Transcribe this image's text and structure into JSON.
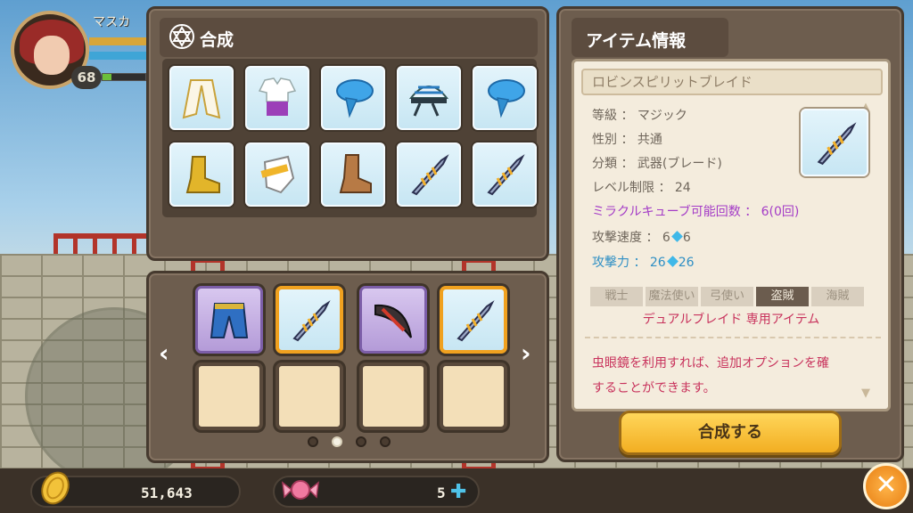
{
  "hud": {
    "player_name": "マスカ",
    "level": "68",
    "exp_fraction": 0.2
  },
  "synthesis": {
    "title": "合成",
    "items": [
      {
        "name": "white-cape"
      },
      {
        "name": "white-shirt-purple-pants"
      },
      {
        "name": "blue-bandana"
      },
      {
        "name": "blue-striped-bandana"
      },
      {
        "name": "blue-bandana"
      },
      {
        "name": "yellow-boots"
      },
      {
        "name": "white-gloves"
      },
      {
        "name": "brown-boots"
      },
      {
        "name": "blade"
      },
      {
        "name": "blade"
      }
    ],
    "materials": [
      {
        "name": "blue-pants",
        "frame": "purple"
      },
      {
        "name": "blade",
        "frame": "orange"
      },
      {
        "name": "katara",
        "frame": "purple"
      },
      {
        "name": "blade",
        "frame": "orange"
      }
    ],
    "pages": 4,
    "current_page": 2
  },
  "item_info": {
    "title": "アイテム情報",
    "item_name": "ロビンスピリットブレイド",
    "grade": "等級 ： マジック",
    "gender": "性別 ： 共通",
    "category": "分類 ： 武器(ブレード)",
    "level_req": "レベル制限 ： 24",
    "miracle_cube": "ミラクルキューブ可能回数 ： 6(0回)",
    "atk_speed_label": "攻撃速度 ： 6",
    "atk_speed_gem": "6",
    "atk_label": "攻撃力 ： 26",
    "atk_gem": "26",
    "jobs": [
      "戦士",
      "魔法使い",
      "弓使い",
      "盗賊",
      "海賊"
    ],
    "active_job": "盗賊",
    "exclusive": "デュアルブレイド 専用アイテム",
    "desc_line1": "虫眼鏡を利用すれば、追加オプションを確",
    "desc_line2": "することができます。",
    "button": "合成する"
  },
  "currency": {
    "meso": "51,643",
    "candy": "5"
  },
  "colors": {
    "accent": "#f2ae22",
    "panel": "#6d5d4e",
    "magic_text": "#a43cc7",
    "attack_text": "#2f8fc4",
    "exclusive_text": "#c8325c"
  }
}
